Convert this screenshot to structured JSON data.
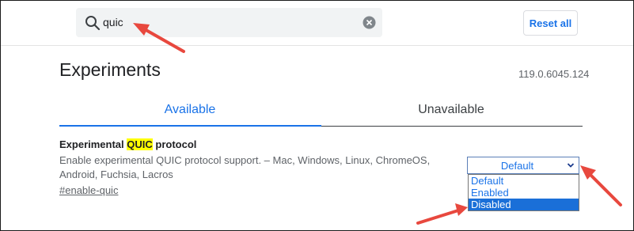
{
  "search": {
    "query": "quic",
    "icon": "search-icon",
    "clear_icon": "clear-icon"
  },
  "toolbar": {
    "reset_label": "Reset all"
  },
  "page": {
    "title": "Experiments",
    "version": "119.0.6045.124"
  },
  "tabs": [
    {
      "label": "Available",
      "active": true
    },
    {
      "label": "Unavailable",
      "active": false
    }
  ],
  "experiment": {
    "name_prefix": "Experimental ",
    "name_highlight": "QUIC",
    "name_suffix": " protocol",
    "description": "Enable experimental QUIC protocol support. – Mac, Windows, Linux, ChromeOS, Android, Fuchsia, Lacros",
    "link": "#enable-quic",
    "select_value": "Default",
    "options": [
      "Default",
      "Enabled",
      "Disabled"
    ],
    "highlighted_option": "Disabled"
  },
  "colors": {
    "accent": "#1a73e8",
    "highlight": "#ffff00",
    "arrow": "#e8483e",
    "selected_option_bg": "#1a6fd8"
  }
}
